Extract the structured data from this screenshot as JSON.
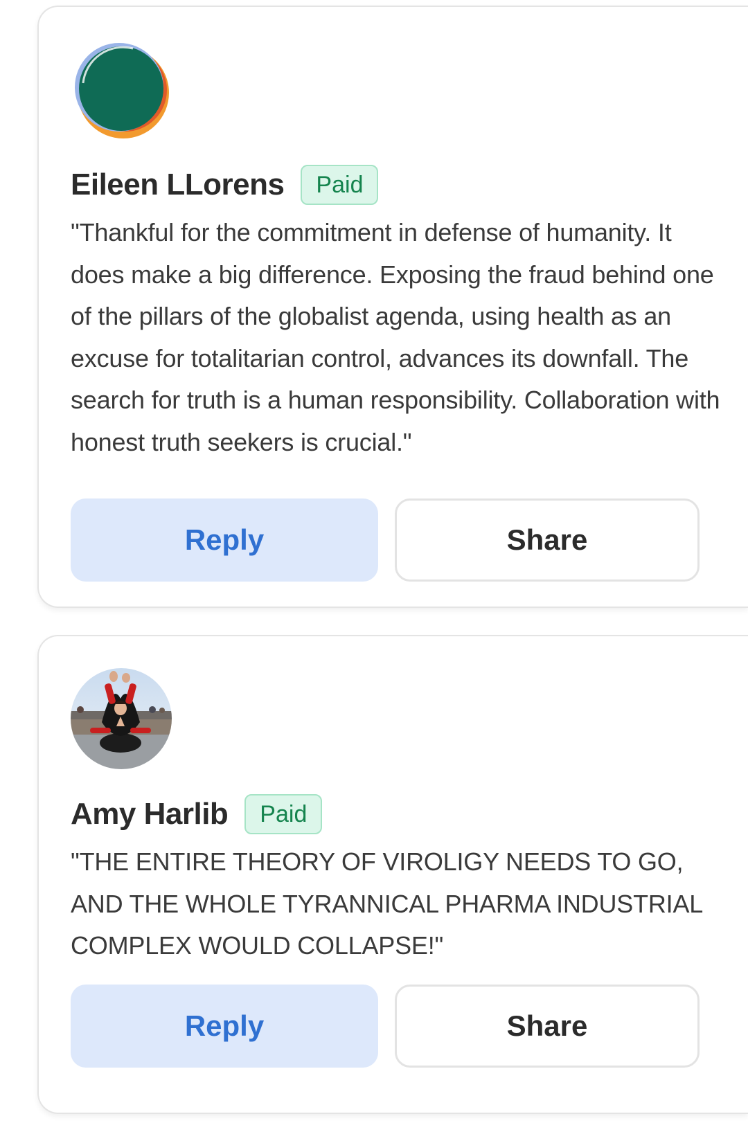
{
  "comments": [
    {
      "author": "Eileen LLorens",
      "badge": "Paid",
      "text": "\"Thankful for the commitment in defense of humanity. It does make a big difference. Exposing the fraud behind one of the pillars of the globalist agenda, using health as an excuse for totalitarian control, advances its downfall. The search for truth is a human responsibility. Collaboration with honest truth seekers is crucial.\"",
      "reply_label": "Reply",
      "share_label": "Share",
      "avatar_icon": "abstract-green-orange-avatar"
    },
    {
      "author": "Amy Harlib",
      "badge": "Paid",
      "text": "\"THE ENTIRE THEORY OF VIROLIGY NEEDS TO GO, AND THE WHOLE TYRANNICAL PHARMA INDUSTRIAL COMPLEX WOULD COLLAPSE!\"",
      "reply_label": "Reply",
      "share_label": "Share",
      "avatar_icon": "yoga-pose-photo-avatar"
    }
  ],
  "colors": {
    "accent_blue": "#2f70d1",
    "reply_bg": "#dde8fb",
    "paid_green": "#15844e",
    "paid_bg": "#dcf6ea"
  }
}
